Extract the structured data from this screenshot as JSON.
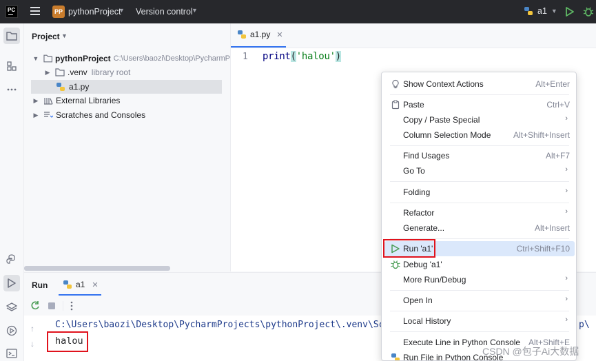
{
  "titlebar": {
    "logo_text": "PC",
    "project_badge": "PP",
    "project_name": "pythonProject",
    "version_control": "Version control",
    "run_config": "a1",
    "icons": [
      "hamburger-menu-icon",
      "chevron-down-icon",
      "python-icon",
      "run-icon",
      "debug-icon"
    ]
  },
  "toolstrip": {
    "icons": [
      "project-folder-icon",
      "structure-icon",
      "more-icon",
      "python-packages-icon",
      "run-icon",
      "layers-icon",
      "services-icon",
      "terminal-icon"
    ]
  },
  "project_panel": {
    "title": "Project",
    "tree": [
      {
        "label": "pythonProject",
        "hint": "C:\\Users\\baozi\\Desktop\\PycharmP",
        "bold": true,
        "expanded": true
      },
      {
        "label": ".venv",
        "hint": "library root",
        "expanded": false
      },
      {
        "label": "a1.py",
        "hint": "",
        "selected": true
      },
      {
        "label": "External Libraries",
        "hint": "",
        "expanded": false
      },
      {
        "label": "Scratches and Consoles",
        "hint": "",
        "expanded": false
      }
    ]
  },
  "editor": {
    "tab_label": "a1.py",
    "line_number": "1",
    "code": {
      "func": "print",
      "open": "(",
      "string": "'halou'",
      "close": ")"
    }
  },
  "run_panel": {
    "title": "Run",
    "tab_label": "a1",
    "console_path": "C:\\Users\\baozi\\Desktop\\PycharmProjects\\pythonProject\\.venv\\Sc",
    "console_path_tail": "p\\",
    "console_output": "halou",
    "scroll_up": "↑",
    "scroll_down": "↓"
  },
  "context_menu": {
    "items": [
      {
        "label": "Show Context Actions",
        "shortcut": "Alt+Enter",
        "icon": "bulb-icon",
        "submenu": false
      },
      {
        "label": "Paste",
        "shortcut": "Ctrl+V",
        "icon": "paste-icon",
        "submenu": false
      },
      {
        "label": "Copy / Paste Special",
        "shortcut": "",
        "submenu": true
      },
      {
        "label": "Column Selection Mode",
        "shortcut": "Alt+Shift+Insert",
        "submenu": false
      },
      {
        "label": "Find Usages",
        "shortcut": "Alt+F7",
        "submenu": false
      },
      {
        "label": "Go To",
        "shortcut": "",
        "submenu": true
      },
      {
        "label": "Folding",
        "shortcut": "",
        "submenu": true
      },
      {
        "label": "Refactor",
        "shortcut": "",
        "submenu": true
      },
      {
        "label": "Generate...",
        "shortcut": "Alt+Insert",
        "submenu": false
      },
      {
        "label": "Run 'a1'",
        "shortcut": "Ctrl+Shift+F10",
        "icon": "run-icon",
        "submenu": false,
        "hovered": true
      },
      {
        "label": "Debug 'a1'",
        "shortcut": "",
        "icon": "debug-icon",
        "submenu": false
      },
      {
        "label": "More Run/Debug",
        "shortcut": "",
        "submenu": true
      },
      {
        "label": "Open In",
        "shortcut": "",
        "submenu": true
      },
      {
        "label": "Local History",
        "shortcut": "",
        "submenu": true
      },
      {
        "label": "Execute Line in Python Console",
        "shortcut": "Alt+Shift+E",
        "submenu": false
      },
      {
        "label": "Run File in Python Console",
        "shortcut": "",
        "icon": "python-icon",
        "submenu": false
      }
    ]
  },
  "watermark": "CSDN @包子Ai大数据",
  "colors": {
    "accent": "#3574f0",
    "highlight_box": "#e0121c",
    "run_green": "#499c54",
    "titlebar": "#27282c"
  }
}
